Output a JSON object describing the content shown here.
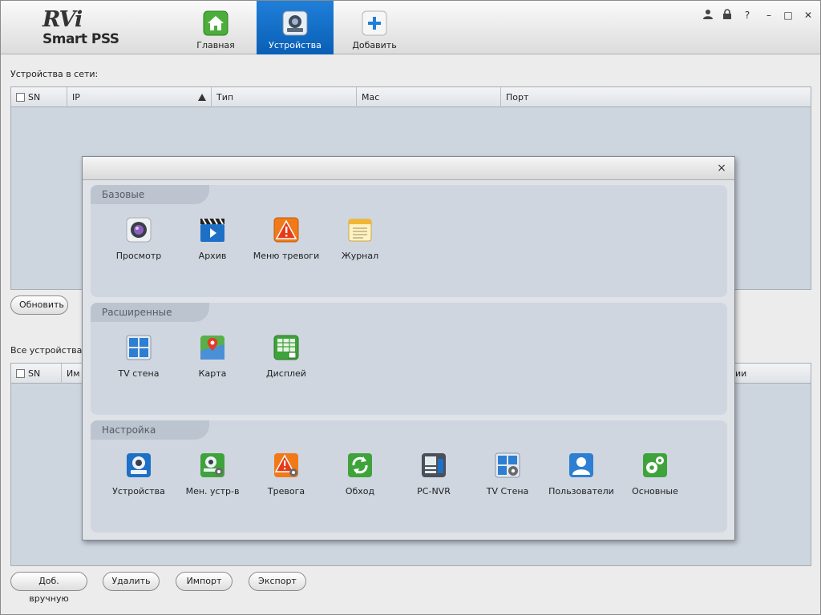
{
  "app": {
    "logo_main": "RVi",
    "logo_sub": "Smart PSS"
  },
  "tabs": [
    {
      "label": "Главная",
      "icon": "home-icon",
      "active": false
    },
    {
      "label": "Устройства",
      "icon": "devices-icon",
      "active": true
    },
    {
      "label": "Добавить",
      "icon": "plus-icon",
      "active": false
    }
  ],
  "window_controls": {
    "user": "👤",
    "lock": "🔒",
    "help": "?",
    "minimize": "–",
    "maximize": "□",
    "close": "✕"
  },
  "online_devices": {
    "label": "Устройства в сети:",
    "columns": [
      "SN",
      "IP",
      "Тип",
      "Mac",
      "Порт"
    ],
    "refresh_button": "Обновить"
  },
  "all_devices": {
    "label": "Все устройства:",
    "columns_visible": [
      "SN",
      "Им",
      "ии"
    ]
  },
  "bottom_buttons": {
    "add_manual": "Доб. вручную",
    "delete": "Удалить",
    "import": "Импорт",
    "export": "Экспорт"
  },
  "menu": {
    "close": "×",
    "groups": [
      {
        "title": "Базовые",
        "items": [
          {
            "label": "Просмотр",
            "icon": "camera-lens-icon"
          },
          {
            "label": "Архив",
            "icon": "clapperboard-icon"
          },
          {
            "label": "Меню тревоги",
            "icon": "alarm-warning-icon"
          },
          {
            "label": "Журнал",
            "icon": "log-notepad-icon"
          }
        ]
      },
      {
        "title": "Расширенные",
        "items": [
          {
            "label": "TV стена",
            "icon": "tv-wall-icon"
          },
          {
            "label": "Карта",
            "icon": "map-pin-icon"
          },
          {
            "label": "Дисплей",
            "icon": "display-grid-icon"
          }
        ]
      },
      {
        "title": "Настройка",
        "items": [
          {
            "label": "Устройства",
            "icon": "device-camera-icon"
          },
          {
            "label": "Мен. устр-в",
            "icon": "device-manager-icon"
          },
          {
            "label": "Тревога",
            "icon": "alarm-settings-icon"
          },
          {
            "label": "Обход",
            "icon": "tour-refresh-icon"
          },
          {
            "label": "PC-NVR",
            "icon": "pc-nvr-icon"
          },
          {
            "label": "TV Стена",
            "icon": "tv-wall-settings-icon"
          },
          {
            "label": "Пользователи",
            "icon": "users-icon"
          },
          {
            "label": "Основные",
            "icon": "general-gears-icon"
          }
        ]
      }
    ]
  },
  "colors": {
    "active_tab": "#0a67c2",
    "table_bg": "#cdd5df",
    "group_bg": "#cfd6df"
  }
}
